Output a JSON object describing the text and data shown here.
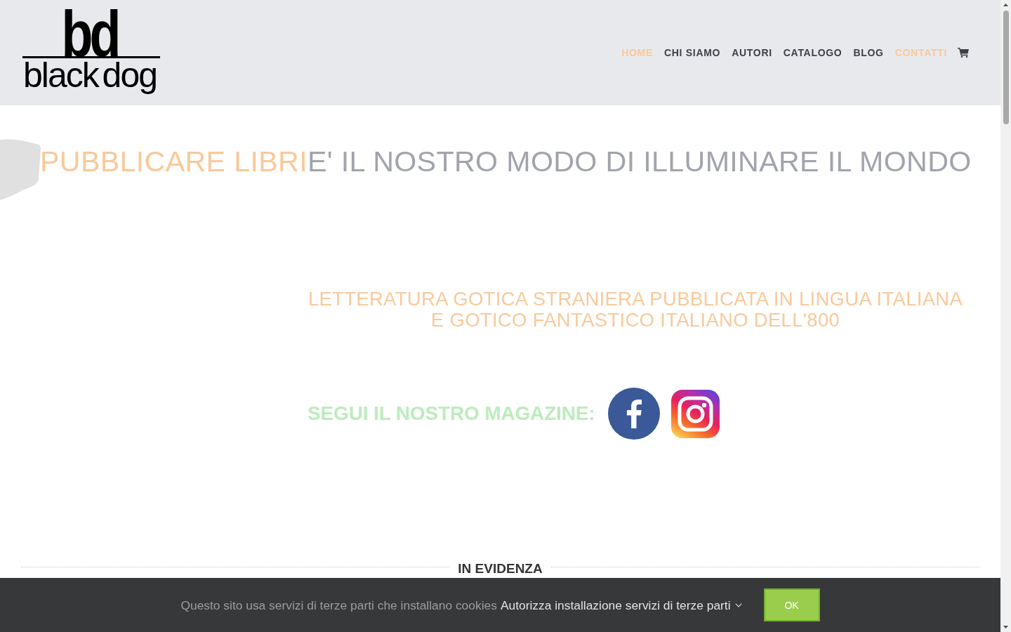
{
  "header": {
    "logo": {
      "monogram": "bd",
      "wordmark": "black dog"
    },
    "nav": [
      {
        "label": "HOME",
        "selected": true
      },
      {
        "label": "CHI SIAMO",
        "selected": false
      },
      {
        "label": "AUTORI",
        "selected": false
      },
      {
        "label": "CATALOGO",
        "selected": false
      },
      {
        "label": "BLOG",
        "selected": false
      },
      {
        "label": "CONTATTI",
        "selected": true
      }
    ]
  },
  "hero": {
    "highlight": "PUBBLICARE LIBRI",
    "text": "E' IL NOSTRO MODO DI ILLUMINARE IL MONDO"
  },
  "tagline": {
    "lines": [
      "LETTERATURA GOTICA STRANIERA PUBBLICATA IN LINGUA ITALIANA",
      "E GOTICO FANTASTICO ITALIANO DELL'800"
    ]
  },
  "social": {
    "label": "SEGUI IL NOSTRO MAGAZINE:"
  },
  "featured": {
    "title": "IN EVIDENZA"
  },
  "cookie_bar": {
    "message": "Questo sito usa servizi di terze parti che installano cookies",
    "link": "Autorizza installazione servizi di terze parti",
    "button": "OK"
  }
}
